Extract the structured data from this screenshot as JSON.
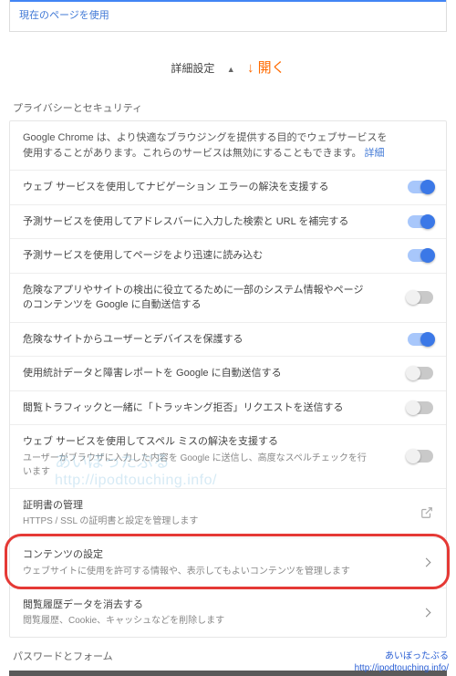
{
  "top_link": "現在のページを使用",
  "advanced": {
    "label": "詳細設定",
    "open_annotation": "↓ 開く"
  },
  "section_privacy": "プライバシーとセキュリティ",
  "intro": {
    "text": "Google Chrome は、より快適なブラウジングを提供する目的でウェブサービスを使用することがあります。これらのサービスは無効にすることもできます。",
    "detail": "詳細"
  },
  "rows": [
    {
      "title": "ウェブ サービスを使用してナビゲーション エラーの解決を支援する",
      "toggle": true
    },
    {
      "title": "予測サービスを使用してアドレスバーに入力した検索と URL を補完する",
      "toggle": true
    },
    {
      "title": "予測サービスを使用してページをより迅速に読み込む",
      "toggle": true
    },
    {
      "title": "危険なアプリやサイトの検出に役立てるために一部のシステム情報やページのコンテンツを Google に自動送信する",
      "toggle": false
    },
    {
      "title": "危険なサイトからユーザーとデバイスを保護する",
      "toggle": true
    },
    {
      "title": "使用統計データと障害レポートを Google に自動送信する",
      "toggle": false
    },
    {
      "title": "閲覧トラフィックと一緒に「トラッキング拒否」リクエストを送信する",
      "toggle": false
    },
    {
      "title": "ウェブ サービスを使用してスペル ミスの解決を支援する",
      "sub": "ユーザーがブラウザに入力した内容を Google に送信し、高度なスペルチェックを行います",
      "toggle": false
    }
  ],
  "cert": {
    "title": "証明書の管理",
    "sub": "HTTPS / SSL の証明書と設定を管理します"
  },
  "content": {
    "title": "コンテンツの設定",
    "sub": "ウェブサイトに使用を許可する情報や、表示してもよいコンテンツを管理します"
  },
  "clear": {
    "title": "閲覧履歴データを消去する",
    "sub": "閲覧履歴、Cookie、キャッシュなどを削除します"
  },
  "section_password": "パスワードとフォーム",
  "credit": {
    "name": "あいぼったぶる",
    "url": "http://ipodtouching.info/"
  },
  "watermark": {
    "line1": "あいぼったぶる",
    "line2": "http://ipodtouching.info/"
  }
}
